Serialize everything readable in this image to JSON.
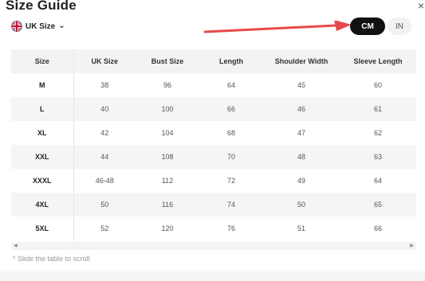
{
  "header": {
    "title": "Size Guide",
    "close_glyph": "×"
  },
  "size_system": {
    "label": "UK Size",
    "icon": "uk-flag-icon"
  },
  "units": {
    "cm": "CM",
    "in": "IN",
    "selected": "CM"
  },
  "table": {
    "columns": [
      "Size",
      "UK Size",
      "Bust Size",
      "Length",
      "Shoulder Width",
      "Sleeve Length"
    ],
    "rows": [
      [
        "M",
        "38",
        "96",
        "64",
        "45",
        "60"
      ],
      [
        "L",
        "40",
        "100",
        "66",
        "46",
        "61"
      ],
      [
        "XL",
        "42",
        "104",
        "68",
        "47",
        "62"
      ],
      [
        "XXL",
        "44",
        "108",
        "70",
        "48",
        "63"
      ],
      [
        "XXXL",
        "46-48",
        "112",
        "72",
        "49",
        "64"
      ],
      [
        "4XL",
        "50",
        "116",
        "74",
        "50",
        "65"
      ],
      [
        "5XL",
        "52",
        "120",
        "76",
        "51",
        "66"
      ]
    ]
  },
  "note": "* Slide the table to scroll",
  "colors": {
    "active_unit_bg": "#111111",
    "arrow": "#e8494a"
  }
}
